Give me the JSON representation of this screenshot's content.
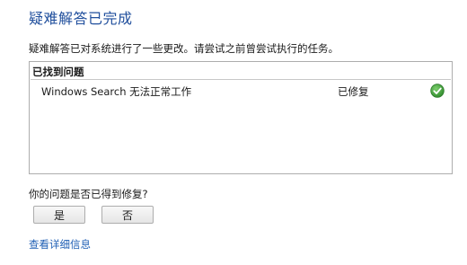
{
  "title": "疑难解答已完成",
  "description": "疑难解答已对系统进行了一些更改。请尝试之前曾尝试执行的任务。",
  "panel": {
    "header": "已找到问题",
    "issues": [
      {
        "name": "Windows Search 无法正常工作",
        "status": "已修复",
        "status_icon": "green-check-icon"
      }
    ]
  },
  "question": "你的问题是否已得到修复?",
  "buttons": {
    "yes": "是",
    "no": "否"
  },
  "details_link": "查看详细信息",
  "colors": {
    "title": "#1f4e9c",
    "link": "#1f5fb4",
    "check": "#3f9a3b"
  }
}
